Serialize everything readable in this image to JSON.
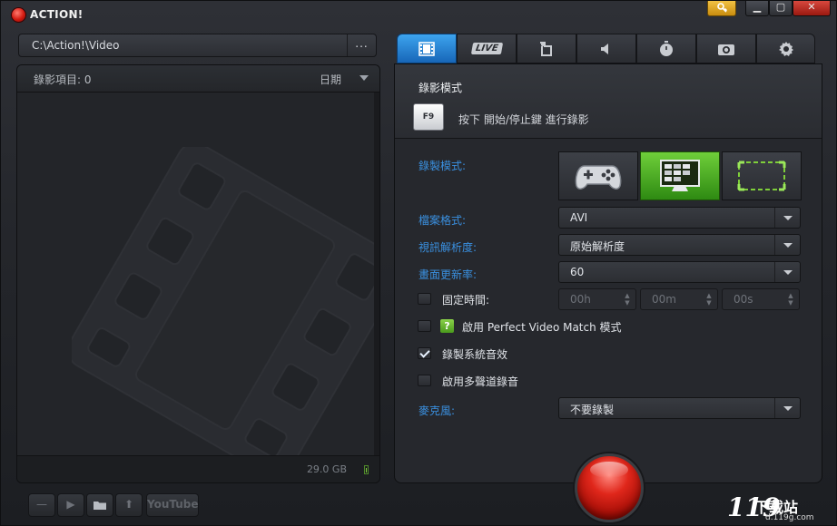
{
  "window": {
    "title": "ACTION!"
  },
  "path": {
    "value": "C:\\Action!\\Video",
    "more_label": "..."
  },
  "list": {
    "count_label": "錄影項目: 0",
    "sort_label": "日期",
    "disk_free": "29.0 GB"
  },
  "bottom_controls": {
    "youtube_label": "YouTube"
  },
  "tabs": [
    {
      "name": "video",
      "icon": "film-icon",
      "active": true
    },
    {
      "name": "live",
      "label": "LIVE",
      "icon": "live-icon",
      "active": false
    },
    {
      "name": "screenshot-area",
      "icon": "crop-icon",
      "active": false
    },
    {
      "name": "audio",
      "icon": "speaker-icon",
      "active": false
    },
    {
      "name": "timer",
      "icon": "stopwatch-icon",
      "active": false
    },
    {
      "name": "camera",
      "icon": "camera-icon",
      "active": false
    },
    {
      "name": "settings",
      "icon": "gear-icon",
      "active": false
    }
  ],
  "mode": {
    "title": "錄影模式",
    "hotkey": "F9",
    "hint": "按下 開始/停止鍵 進行錄影"
  },
  "fields": {
    "recording_mode_label": "錄製模式:",
    "recording_modes": [
      {
        "name": "game",
        "icon": "gamepad-icon",
        "active": false
      },
      {
        "name": "desktop",
        "icon": "monitor-icon",
        "active": true
      },
      {
        "name": "region",
        "icon": "region-icon",
        "active": false
      }
    ],
    "file_format_label": "檔案格式:",
    "file_format": "AVI",
    "resolution_label": "視訊解析度:",
    "resolution": "原始解析度",
    "framerate_label": "畫面更新率:",
    "framerate": "60",
    "fixed_time_label": "固定時間:",
    "fixed_time_hours": "00h",
    "fixed_time_minutes": "00m",
    "fixed_time_seconds": "00s",
    "pvm_label": "啟用 Perfect Video Match 模式",
    "system_audio_label": "錄製系統音效",
    "multi_track_label": "啟用多聲道錄音",
    "microphone_label": "麥克風:",
    "microphone": "不要錄製"
  },
  "checks": {
    "fixed_time": false,
    "pvm": false,
    "system_audio": true,
    "multi_track": false
  },
  "watermark": {
    "text": "下载站",
    "url": "d.119g.com"
  },
  "colors": {
    "accent_blue": "#3a90e0",
    "active_tab": "#2a85d6",
    "active_mode": "#4fb42a",
    "record_red": "#e0271b"
  }
}
